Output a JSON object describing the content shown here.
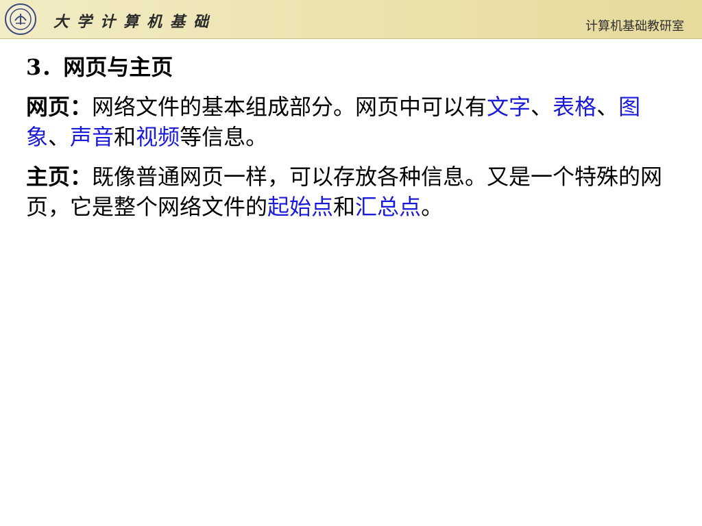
{
  "header": {
    "title": "大学计算机基础",
    "right_label": "计算机基础教研室"
  },
  "content": {
    "heading": "3．网页与主页",
    "p1": {
      "term": "网页：",
      "t1": "网络文件的基本组成部分。网页中可以有",
      "h1": "文字",
      "s1": "、",
      "h2": "表格",
      "s2": "、",
      "h3": "图象",
      "s3": "、",
      "h4": "声音",
      "s4": "和",
      "h5": "视频",
      "t2": "等信息。"
    },
    "p2": {
      "term": "主页：",
      "t1": "既像普通网页一样，可以存放各种信息。又是一个特殊的网页，它是整个网络文件的",
      "h1": "起始点",
      "s1": "和",
      "h2": "汇总点",
      "t2": "。"
    }
  },
  "colors": {
    "highlight": "#1a1adb",
    "header_bg": "#ece3b0"
  }
}
